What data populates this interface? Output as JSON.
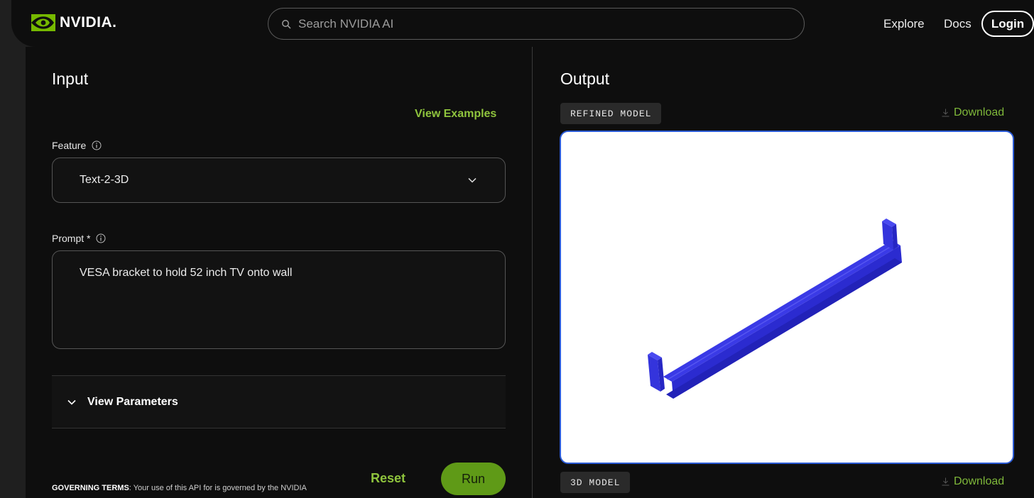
{
  "header": {
    "brand": "NVIDIA.",
    "search_placeholder": "Search NVIDIA AI",
    "nav": {
      "explore": "Explore",
      "docs": "Docs",
      "login": "Login"
    }
  },
  "input_panel": {
    "title": "Input",
    "view_examples": "View Examples",
    "feature_label": "Feature",
    "feature_value": "Text-2-3D",
    "prompt_label": "Prompt *",
    "prompt_value": "VESA bracket to hold 52 inch TV onto wall",
    "view_parameters": "View Parameters",
    "governing_title": "GOVERNING TERMS",
    "governing_text": ": Your use of this API for is governed by the NVIDIA",
    "reset": "Reset",
    "run": "Run"
  },
  "output_panel": {
    "title": "Output",
    "refined_tag": "REFINED MODEL",
    "model_tag": "3D MODEL",
    "download_1": "Download",
    "download_2": "Download"
  },
  "colors": {
    "accent_green": "#76b900",
    "link_green": "#8fc43d",
    "model_blue": "#3232d6",
    "viewer_border": "#2b5bd6"
  },
  "icons": {
    "search": "search-icon",
    "info": "info-icon",
    "chevron": "chevron-down-icon",
    "download": "download-icon",
    "logo": "nvidia-eye-logo"
  }
}
